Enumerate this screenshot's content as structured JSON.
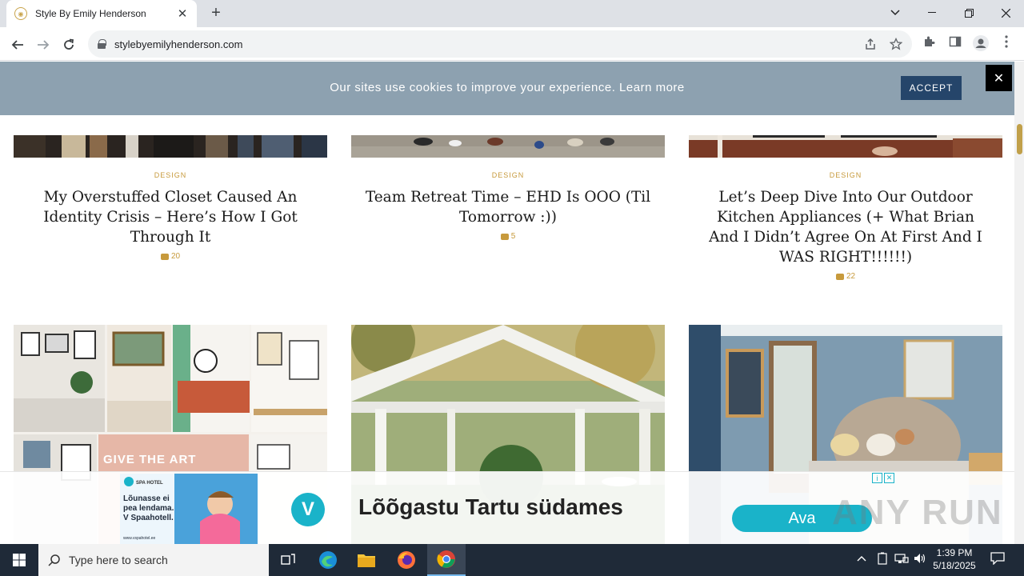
{
  "browser": {
    "tab_title": "Style By Emily Henderson",
    "tab_close": "✕",
    "new_tab": "+",
    "url": "stylebyemilyhenderson.com"
  },
  "cookie_banner": {
    "text": "Our sites use cookies to improve your experience.",
    "link": "Learn more",
    "accept": "ACCEPT",
    "close": "✕"
  },
  "posts": [
    {
      "category": "DESIGN",
      "title": "My Overstuffed Closet Caused An Identity Crisis – Here’s How I Got Through It",
      "comments": "20"
    },
    {
      "category": "DESIGN",
      "title": "Team Retreat Time – EHD Is OOO (Til Tomorrow :))",
      "comments": "5"
    },
    {
      "category": "DESIGN",
      "title": "Let’s Deep Dive Into Our Outdoor Kitchen Appliances (+ What Brian And I Didn’t Agree On At First And I WAS RIGHT!!!!!!)",
      "comments": "22"
    }
  ],
  "featured": [
    {
      "overlay": "GIVE THE ART"
    }
  ],
  "ad": {
    "thumb_brand": "SPA HOTEL",
    "thumb_text": "Lõunasse ei pea lendama. V Spaahotell.",
    "thumb_url": "www.vspahotel.ee",
    "logo": "V",
    "headline": "Lõõgastu Tartu südames",
    "cta": "Ava",
    "info": "i",
    "close": "✕"
  },
  "watermark": "ANY RUN",
  "taskbar": {
    "search_placeholder": "Type here to search",
    "time": "1:39 PM",
    "date": "5/18/2025"
  }
}
